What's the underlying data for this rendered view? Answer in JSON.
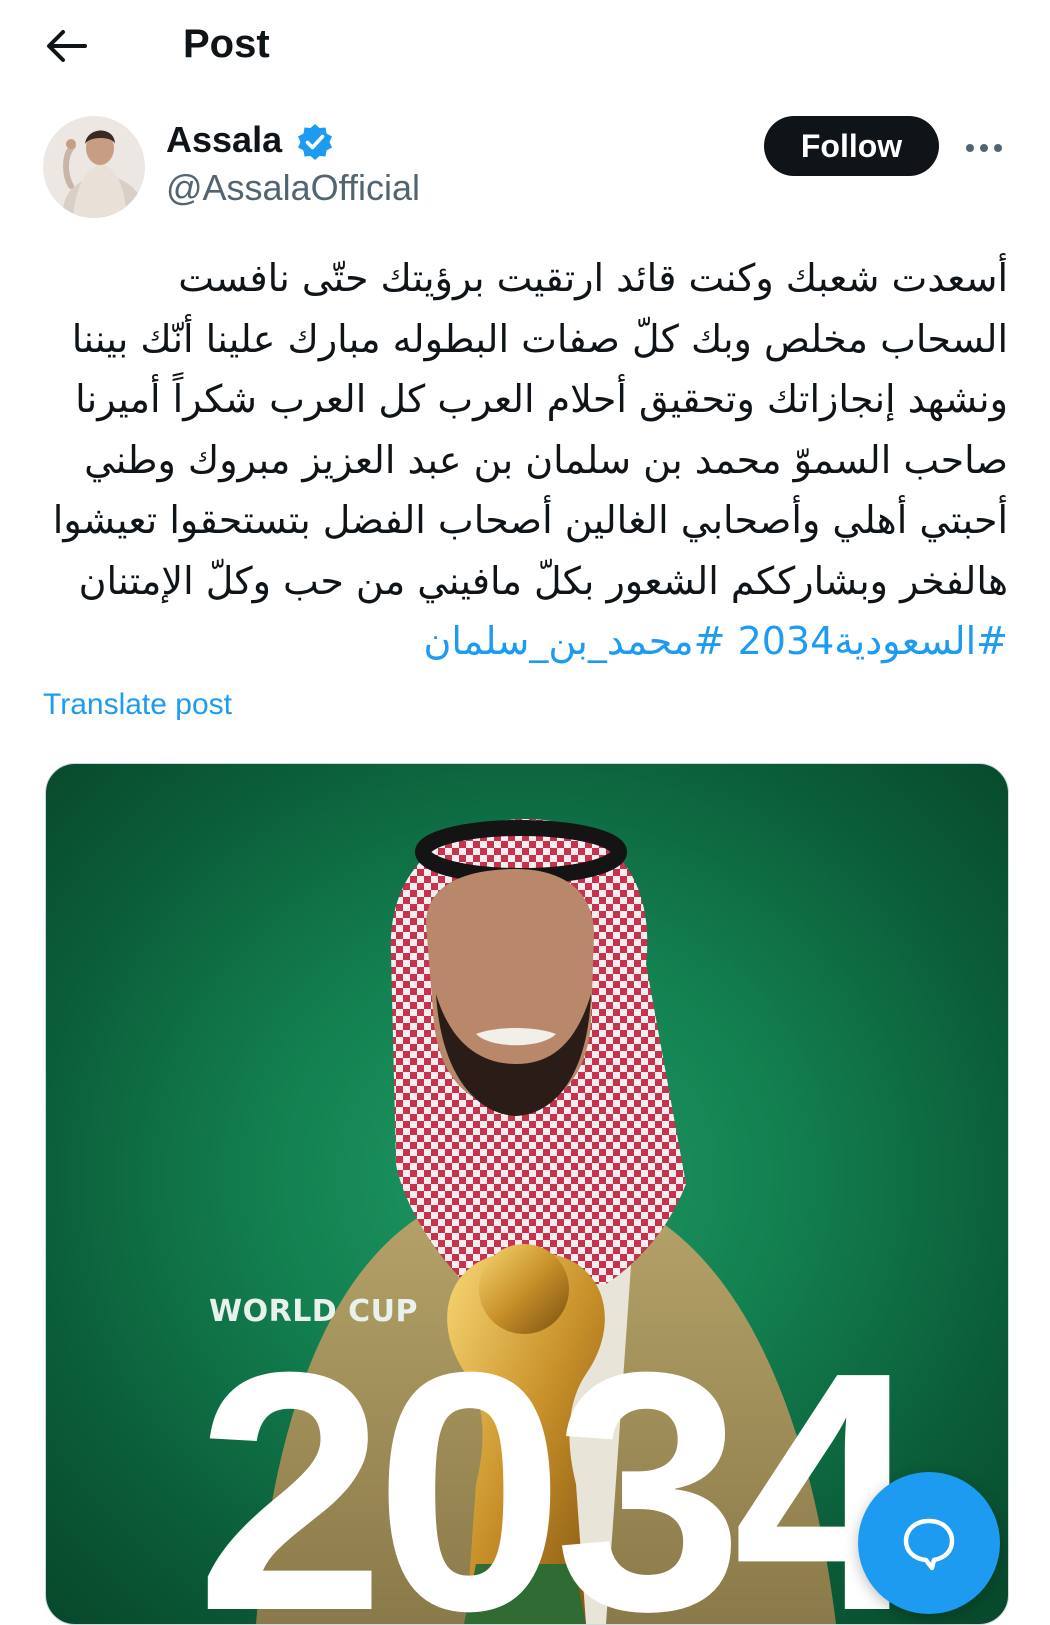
{
  "header": {
    "back_icon": "arrow-left-icon",
    "title": "Post"
  },
  "author": {
    "name": "Assala",
    "handle": "@AssalaOfficial",
    "verified_icon": "verified-badge-icon",
    "follow_label": "Follow",
    "more_icon": "more-horizontal-icon"
  },
  "post": {
    "text": "أسعدت شعبك وكنت قائد ارتقيت برؤيتك حتّى نافست السحاب مخلص وبك كلّ صفات البطوله مبارك علينا أنّك بيننا ونشهد إنجازاتك وتحقيق أحلام العرب كل العرب شكراً أميرنا صاحب السموّ محمد بن سلمان بن عبد العزيز مبروك وطني أحبتي أهلي وأصحابي الغالين أصحاب الفضل بتستحقوا تعيشوا هالفخر وبشارككم الشعور بكلّ مافيني من حب وكلّ الإمتنان",
    "hashtag_1": "#السعودية2034",
    "hashtag_2": "#محمد_بن_سلمان",
    "translate_label": "Translate post"
  },
  "media": {
    "caption_small": "WORLD CUP",
    "caption_large": "2034"
  },
  "fab": {
    "icon": "compose-reply-icon"
  },
  "colors": {
    "accent": "#1d9bf0",
    "text_primary": "#0f1419",
    "text_secondary": "#536471",
    "follow_bg": "#0f1419",
    "media_green": "#138050"
  }
}
